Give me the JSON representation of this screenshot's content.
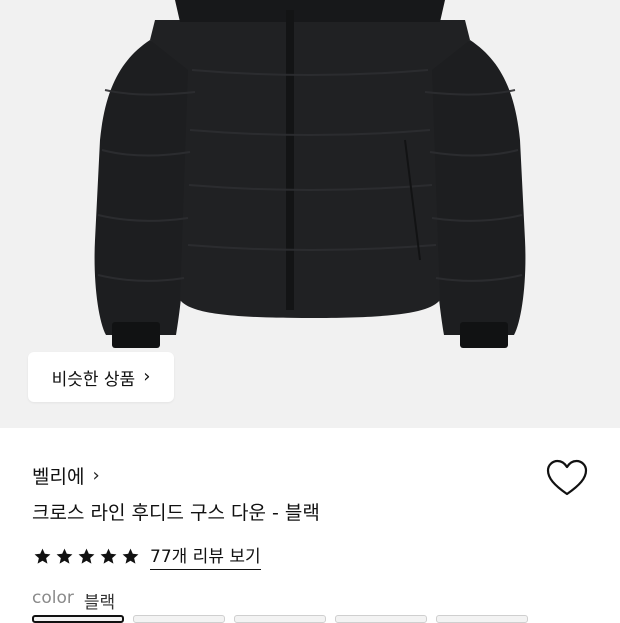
{
  "hero": {
    "similar_products_label": "비슷한 상품",
    "similar_chevron": "›"
  },
  "product": {
    "brand": "벨리에",
    "brand_chevron": "›",
    "name": "크로스 라인 후디드 구스 다운 - 블랙",
    "rating_stars": 5,
    "review_link": "77개 리뷰 보기",
    "color_label": "color",
    "color_value": "블랙"
  },
  "colors": {
    "star": "#111111",
    "hero_bg": "#f1f1f1",
    "jacket": "#1e1f21"
  },
  "icons": {
    "wishlist": "heart-outline-icon",
    "star": "star-filled-icon"
  }
}
